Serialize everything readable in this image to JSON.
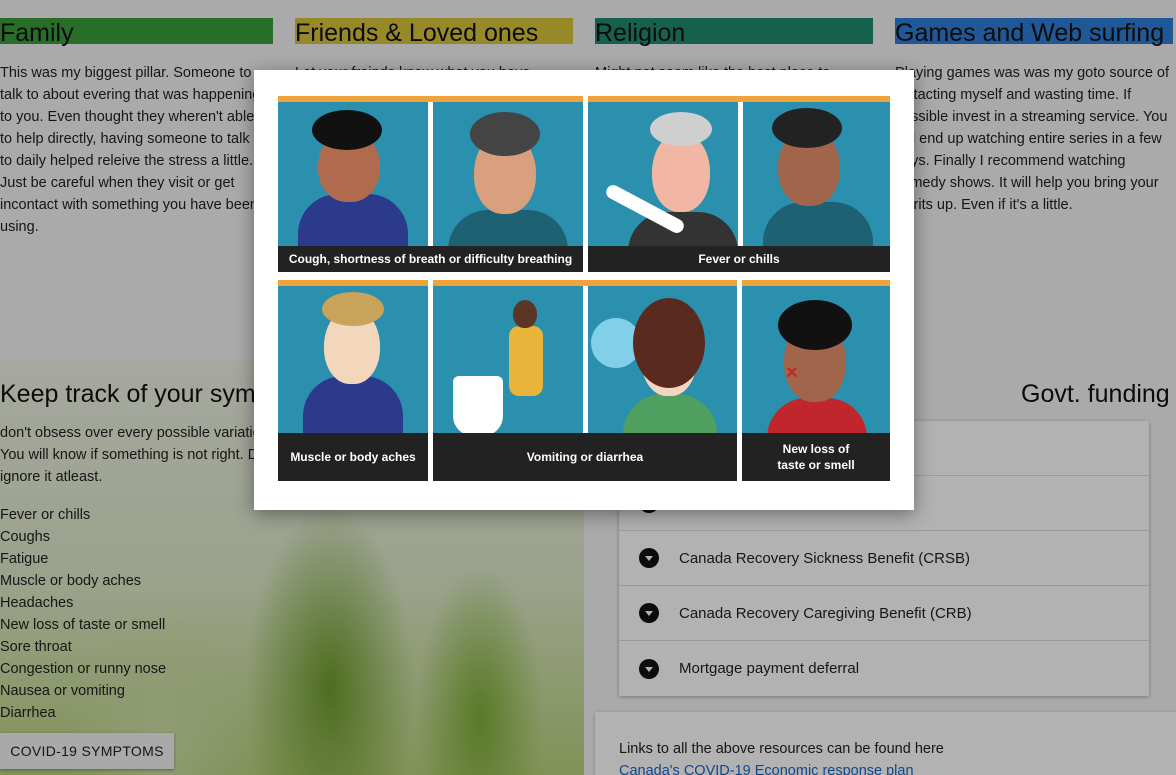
{
  "columns": [
    {
      "title": "Family",
      "bar": "#3a9c3a",
      "text": "This was my biggest pillar. Someone to talk to about evering that was happening to you. Even thought they wheren't able to help directly, having someone to talk to daily helped releive the stress a little. Just be careful when they visit or get incontact with something you have been using."
    },
    {
      "title": "Friends & Loved ones",
      "bar": "#d8c43a",
      "text": "Let your freinds know what you have"
    },
    {
      "title": "Religion",
      "bar": "#1f8c70",
      "text": "Might not seem like the best place to"
    },
    {
      "title": "Games and Web surfing",
      "bar": "#2f7fd9",
      "text": "Playing games was was my goto source of distacting myself and wasting time. If possible invest in a streaming service. You will end up watching entire series in a few days. Finally I recommend watching comedy shows. It will help you bring your spirits up. Even if it's a little."
    }
  ],
  "symptoms": {
    "title": "Keep track of your symptoms",
    "description": "don't obsess over every possible variation. You will know if something is not right. Don't ignore it atleast.",
    "list": [
      "Fever or chills",
      "Coughs",
      "Fatigue",
      "Muscle or body aches",
      "Headaches",
      "New loss of taste or smell",
      "Sore throat",
      "Congestion or runny nose",
      "Nausea or vomiting",
      "Diarrhea"
    ],
    "button_label": "COVID-19 SYMPTOMS"
  },
  "funding": {
    "title": "Govt. funding",
    "items": [
      "",
      "",
      "Canada Recovery Sickness Benefit (CRSB)",
      "Canada Recovery Caregiving Benefit (CRB)",
      "Mortgage payment deferral"
    ],
    "links_text": "Links to all the above resources can be found here",
    "link_label": "Canada's COVID-19 Economic response plan"
  },
  "modal": {
    "captions": {
      "cough": "Cough, shortness of breath or difficulty breathing",
      "fever": "Fever or chills",
      "aches": "Muscle or body aches",
      "vomit": "Vomiting or diarrhea",
      "taste_line1": "New loss of",
      "taste_line2": "taste or smell"
    },
    "colors": {
      "panel": "#2b8fae",
      "stripe": "#f0a33a",
      "caption": "#222222"
    }
  }
}
